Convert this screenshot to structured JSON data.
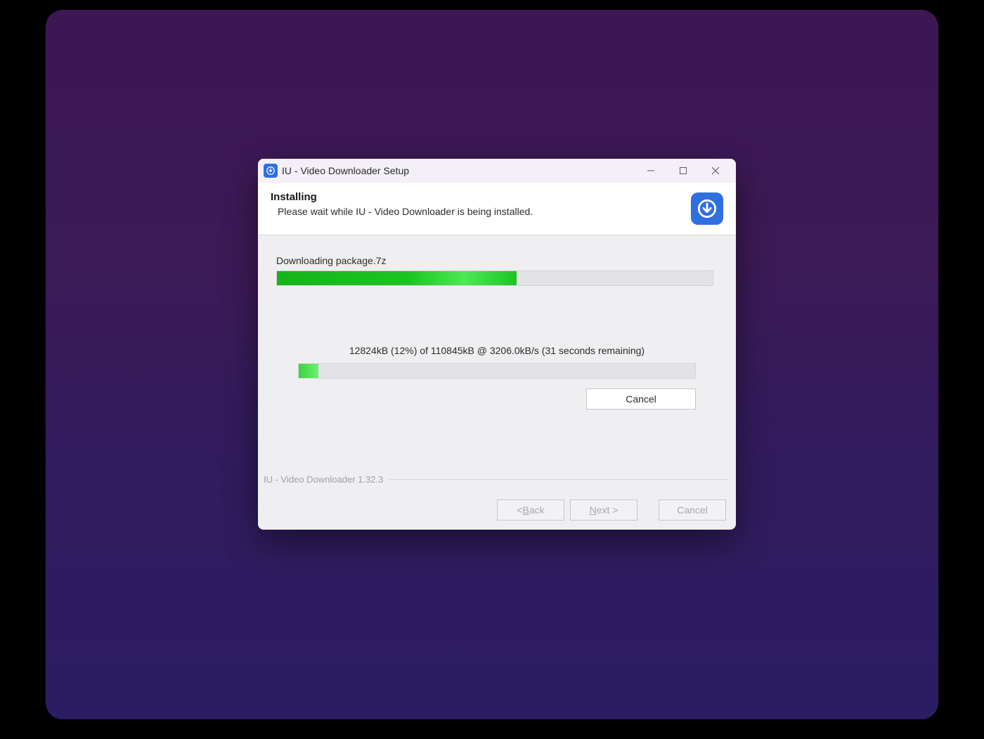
{
  "titlebar": {
    "title": "IU - Video Downloader Setup"
  },
  "header": {
    "heading": "Installing",
    "subtitle": "Please wait while IU - Video Downloader is being installed."
  },
  "progress": {
    "task_label": "Downloading package.7z",
    "main_percent": 55,
    "download_status": "12824kB (12%) of 110845kB @ 3206.0kB/s (31 seconds remaining)",
    "download_percent": 5,
    "cancel_label": "Cancel"
  },
  "version": "IU - Video Downloader 1.32.3",
  "footer": {
    "back": "ack",
    "back_prefix": "< ",
    "back_u": "B",
    "next_u": "N",
    "next": "ext >",
    "cancel": "Cancel"
  }
}
